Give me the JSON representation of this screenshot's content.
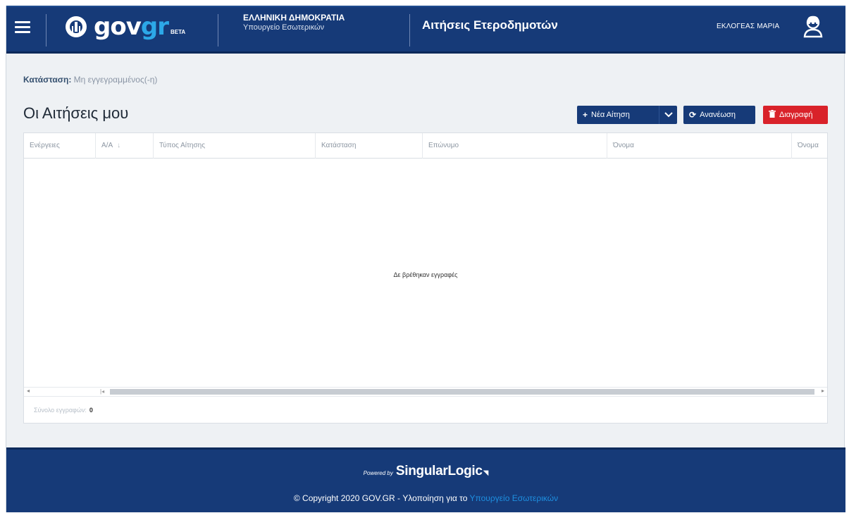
{
  "header": {
    "logo_main": "gov",
    "logo_accent": "gr",
    "logo_badge": "BETA",
    "ministry_line1": "ΕΛΛΗΝΙΚΗ ΔΗΜΟΚΡΑΤΙΑ",
    "ministry_line2": "Υπουργείο Εσωτερικών",
    "app_title": "Αιτήσεις Ετεροδημοτών",
    "user_name": "ΕΚΛΟΓΕΑΣ ΜΑΡΙΑ"
  },
  "status": {
    "label": "Κατάσταση:",
    "value": "Μη εγγεγραμμένος(-η)"
  },
  "page_title": "Οι Αιτήσεις μου",
  "toolbar": {
    "new_label": "Νέα Αίτηση",
    "refresh_label": "Ανανέωση",
    "delete_label": "Διαγραφή"
  },
  "grid": {
    "columns": [
      "Ενέργειες",
      "Α/Α",
      "Τύπος Αίτησης",
      "Κατάσταση",
      "Επώνυμο",
      "Όνομα",
      "Όνομα"
    ],
    "empty_message": "Δε βρέθηκαν εγγραφές",
    "footer_label": "Σύνολο εγγραφών:",
    "footer_count": "0"
  },
  "footer": {
    "powered_by": "Powered by",
    "brand": "SingularLogic",
    "copyright_text": "© Copyright 2020 GOV.GR - Υλοποίηση για το",
    "copyright_link": "Υπουργείο Εσωτερικών"
  },
  "colors": {
    "primary": "#163a78",
    "danger": "#d9222a",
    "accent": "#2ca8e8",
    "link": "#1e8fe0"
  }
}
